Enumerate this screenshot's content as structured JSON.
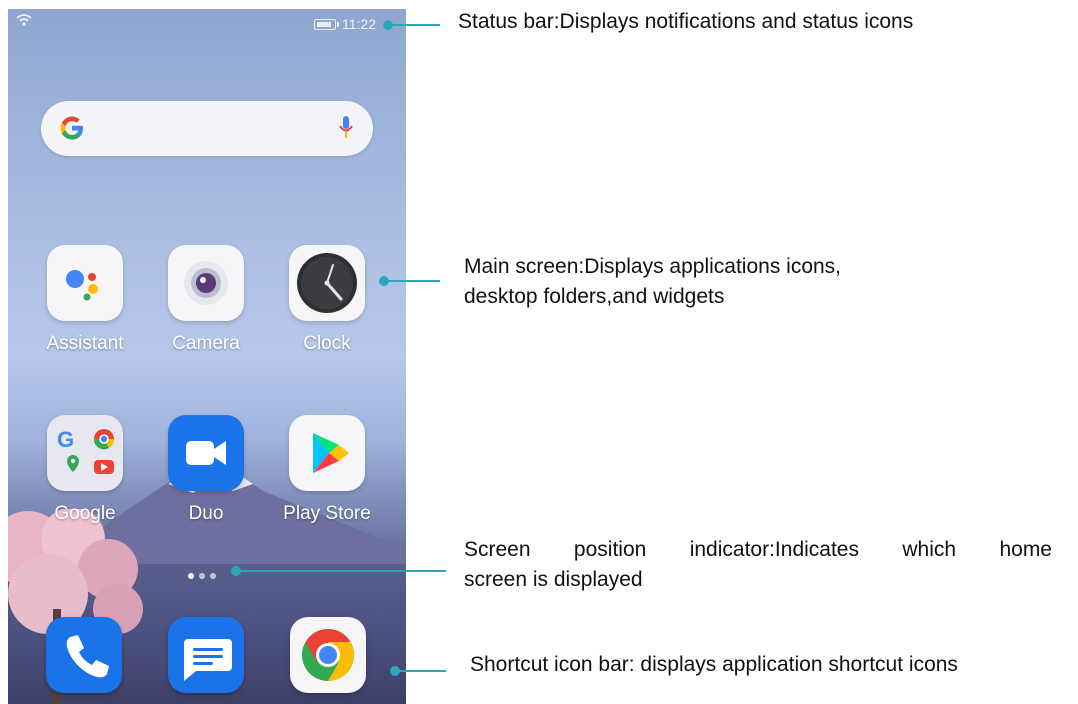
{
  "status_bar": {
    "time": "11:22"
  },
  "search": {},
  "apps": [
    {
      "label": "Assistant",
      "icon": "assistant-icon"
    },
    {
      "label": "Camera",
      "icon": "camera-icon"
    },
    {
      "label": "Clock",
      "icon": "clock-icon"
    },
    {
      "label": "Google",
      "icon": "google-folder-icon"
    },
    {
      "label": "Duo",
      "icon": "duo-icon"
    },
    {
      "label": "Play Store",
      "icon": "play-store-icon"
    }
  ],
  "dock": [
    {
      "icon": "phone-icon"
    },
    {
      "icon": "messages-icon"
    },
    {
      "icon": "chrome-icon"
    }
  ],
  "page_indicator": {
    "pages": 3,
    "active": 1
  },
  "annotations": {
    "status_bar": "Status bar:Displays notifications and status icons",
    "main_screen_line1": "Main screen:Displays applications icons,",
    "main_screen_line2": "desktop folders,and widgets",
    "indicator_line1": "Screen position indicator:Indicates which home",
    "indicator_line2": "screen is displayed",
    "shortcut_bar": "Shortcut icon bar: displays application shortcut icons"
  },
  "colors": {
    "callout": "#2aa7bb",
    "wallpaper_top": "#8ea6cf",
    "wallpaper_bottom": "#3b3f6a"
  }
}
